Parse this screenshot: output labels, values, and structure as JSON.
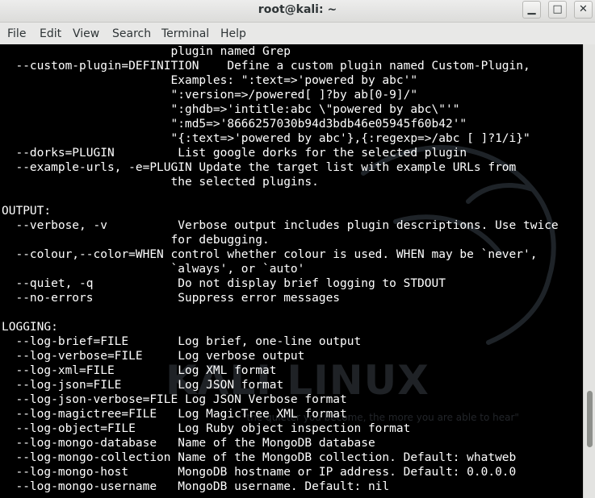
{
  "window": {
    "title": "root@kali: ~",
    "min_glyph": "▁",
    "max_glyph": "□",
    "close_glyph": "✕"
  },
  "menu": [
    "File",
    "Edit",
    "View",
    "Search",
    "Terminal",
    "Help"
  ],
  "terminal": {
    "lines": [
      "                        plugin named Grep",
      "  --custom-plugin=DEFINITION    Define a custom plugin named Custom-Plugin,",
      "                        Examples: \":text=>'powered by abc'\"",
      "                        \":version=>/powered[ ]?by ab[0-9]/\"",
      "                        \":ghdb=>'intitle:abc \\\"powered by abc\\\"'\"",
      "                        \":md5=>'8666257030b94d3bdb46e05945f60b42'\"",
      "                        \"{:text=>'powered by abc'},{:regexp=>/abc [ ]?1/i}\"",
      "  --dorks=PLUGIN         List google dorks for the selected plugin",
      "  --example-urls, -e=PLUGIN Update the target list with example URLs from",
      "                        the selected plugins.",
      "",
      "OUTPUT:",
      "  --verbose, -v          Verbose output includes plugin descriptions. Use twice",
      "                        for debugging.",
      "  --colour,--color=WHEN control whether colour is used. WHEN may be `never',",
      "                        `always', or `auto'",
      "  --quiet, -q            Do not display brief logging to STDOUT",
      "  --no-errors            Suppress error messages",
      "",
      "LOGGING:",
      "  --log-brief=FILE       Log brief, one-line output",
      "  --log-verbose=FILE     Log verbose output",
      "  --log-xml=FILE         Log XML format",
      "  --log-json=FILE        Log JSON format",
      "  --log-json-verbose=FILE Log JSON Verbose format",
      "  --log-magictree=FILE   Log MagicTree XML format",
      "  --log-object=FILE      Log Ruby object inspection format",
      "  --log-mongo-database   Name of the MongoDB database",
      "  --log-mongo-collection Name of the MongoDB collection. Default: whatweb",
      "  --log-mongo-host       MongoDB hostname or IP address. Default: 0.0.0.0",
      "  --log-mongo-username   MongoDB username. Default: nil"
    ],
    "background": "#000000",
    "foreground": "#ffffff"
  },
  "watermark": {
    "text": "KALI LINUX",
    "tagline": "\"the quieter you become, the more you are able to hear\""
  }
}
